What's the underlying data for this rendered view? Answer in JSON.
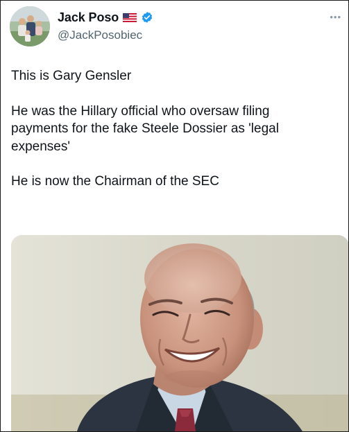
{
  "tweet": {
    "display_name": "Jack Poso",
    "handle": "@JackPosobiec",
    "flag_icon": "us-flag-icon",
    "verified_icon": "verified-badge-icon",
    "more_icon": "ellipsis-icon",
    "text": {
      "p1": "This is Gary Gensler",
      "p2": "He was the Hillary official who oversaw filing\npayments for the fake Steele Dossier as 'legal\nexpenses'",
      "p3": "He is now the Chairman of the SEC"
    },
    "media": {
      "icon": "photo",
      "description_colors": {
        "background": "#d9d8cc",
        "suit": "#2b3440",
        "skin": "#c99a86"
      }
    }
  },
  "colors": {
    "text": "#0f1419",
    "secondary": "#536471",
    "verified": "#1d9bf0"
  }
}
